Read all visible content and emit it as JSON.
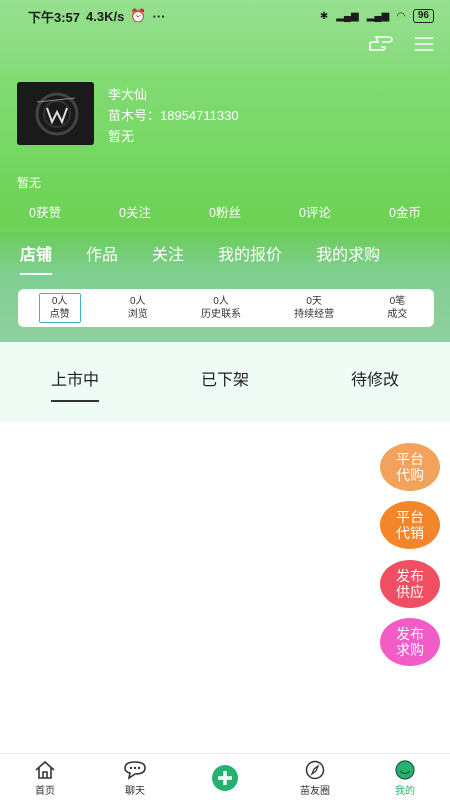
{
  "statusbar": {
    "time": "下午3:57",
    "speed": "4.3K/s",
    "battery": "96"
  },
  "profile": {
    "name": "李大仙",
    "id_label": "苗木号：",
    "id_value": "18954711330",
    "extra": "暂无",
    "bio": "暂无"
  },
  "stats": [
    {
      "label": "0获赞"
    },
    {
      "label": "0关注"
    },
    {
      "label": "0粉丝"
    },
    {
      "label": "0评论"
    },
    {
      "label": "0金币"
    }
  ],
  "tabs": [
    "店铺",
    "作品",
    "关注",
    "我的报价",
    "我的求购"
  ],
  "shop_stats": [
    {
      "value": "0人",
      "label": "点赞"
    },
    {
      "value": "0人",
      "label": "浏览"
    },
    {
      "value": "0人",
      "label": "历史联系"
    },
    {
      "value": "0天",
      "label": "持续经营"
    },
    {
      "value": "0笔",
      "label": "成交"
    }
  ],
  "subtabs": [
    "上市中",
    "已下架",
    "待修改"
  ],
  "fabs": [
    {
      "label": "平台\n代购",
      "color": "#f2a25a"
    },
    {
      "label": "平台\n代销",
      "color": "#f3862b"
    },
    {
      "label": "发布\n供应",
      "color": "#f04e62"
    },
    {
      "label": "发布\n求购",
      "color": "#f25cc6"
    }
  ],
  "bottomnav": [
    {
      "label": "首页",
      "icon": "home-icon"
    },
    {
      "label": "聊天",
      "icon": "chat-icon"
    },
    {
      "label": "",
      "icon": "add-icon"
    },
    {
      "label": "苗友圈",
      "icon": "compass-icon"
    },
    {
      "label": "我的",
      "icon": "user-icon"
    }
  ],
  "colors": {
    "accent": "#23b36f",
    "header_green": "#66cc4d"
  }
}
